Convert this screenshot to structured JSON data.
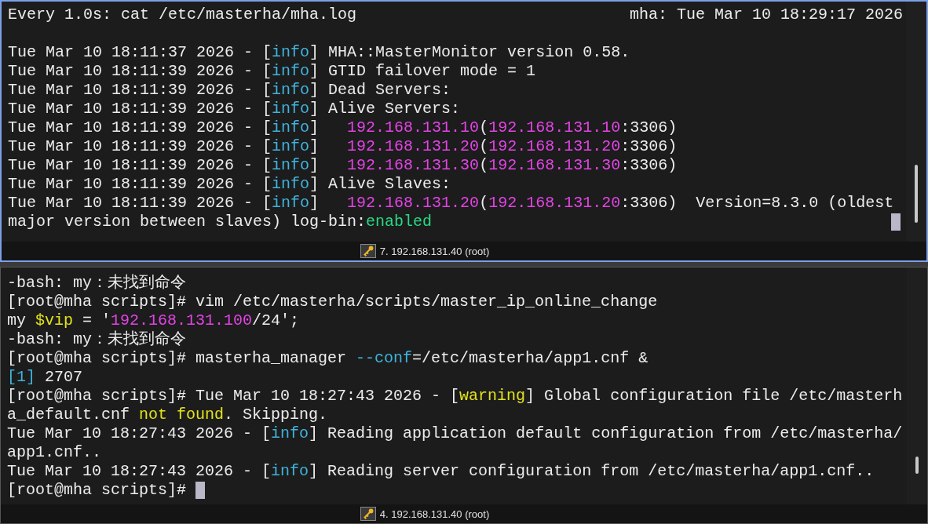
{
  "panes": [
    {
      "active": true,
      "header": {
        "command": "Every 1.0s: cat /etc/masterha/mha.log",
        "clock": "mha: Tue Mar 10 18:29:17 2026"
      },
      "lines": [
        [
          {
            "kind": "plain",
            "text": "Tue Mar 10 18:11:37 2026 - ["
          },
          {
            "kind": "tag",
            "text": "info"
          },
          {
            "kind": "plain",
            "text": "] MHA::MasterMonitor version 0.58."
          }
        ],
        [
          {
            "kind": "plain",
            "text": "Tue Mar 10 18:11:39 2026 - ["
          },
          {
            "kind": "tag",
            "text": "info"
          },
          {
            "kind": "plain",
            "text": "] GTID failover mode = 1"
          }
        ],
        [
          {
            "kind": "plain",
            "text": "Tue Mar 10 18:11:39 2026 - ["
          },
          {
            "kind": "tag",
            "text": "info"
          },
          {
            "kind": "plain",
            "text": "] Dead Servers:"
          }
        ],
        [
          {
            "kind": "plain",
            "text": "Tue Mar 10 18:11:39 2026 - ["
          },
          {
            "kind": "tag",
            "text": "info"
          },
          {
            "kind": "plain",
            "text": "] Alive Servers:"
          }
        ],
        [
          {
            "kind": "plain",
            "text": "Tue Mar 10 18:11:39 2026 - ["
          },
          {
            "kind": "tag",
            "text": "info"
          },
          {
            "kind": "plain",
            "text": "]   "
          },
          {
            "kind": "address",
            "text": "192.168.131.10"
          },
          {
            "kind": "plain",
            "text": "("
          },
          {
            "kind": "address",
            "text": "192.168.131.10"
          },
          {
            "kind": "plain",
            "text": ":3306)"
          }
        ],
        [
          {
            "kind": "plain",
            "text": "Tue Mar 10 18:11:39 2026 - ["
          },
          {
            "kind": "tag",
            "text": "info"
          },
          {
            "kind": "plain",
            "text": "]   "
          },
          {
            "kind": "address",
            "text": "192.168.131.20"
          },
          {
            "kind": "plain",
            "text": "("
          },
          {
            "kind": "address",
            "text": "192.168.131.20"
          },
          {
            "kind": "plain",
            "text": ":3306)"
          }
        ],
        [
          {
            "kind": "plain",
            "text": "Tue Mar 10 18:11:39 2026 - ["
          },
          {
            "kind": "tag",
            "text": "info"
          },
          {
            "kind": "plain",
            "text": "]   "
          },
          {
            "kind": "address",
            "text": "192.168.131.30"
          },
          {
            "kind": "plain",
            "text": "("
          },
          {
            "kind": "address",
            "text": "192.168.131.30"
          },
          {
            "kind": "plain",
            "text": ":3306)"
          }
        ],
        [
          {
            "kind": "plain",
            "text": "Tue Mar 10 18:11:39 2026 - ["
          },
          {
            "kind": "tag",
            "text": "info"
          },
          {
            "kind": "plain",
            "text": "] Alive Slaves:"
          }
        ],
        [
          {
            "kind": "plain",
            "text": "Tue Mar 10 18:11:39 2026 - ["
          },
          {
            "kind": "tag",
            "text": "info"
          },
          {
            "kind": "plain",
            "text": "]   "
          },
          {
            "kind": "address",
            "text": "192.168.131.20"
          },
          {
            "kind": "plain",
            "text": "("
          },
          {
            "kind": "address",
            "text": "192.168.131.20"
          },
          {
            "kind": "plain",
            "text": ":3306)  Version=8.3.0 (oldest"
          }
        ],
        [
          {
            "kind": "plain",
            "text": "major version between slaves) log-bin:"
          },
          {
            "kind": "value",
            "text": "enabled"
          },
          {
            "kind": "margincursor"
          }
        ]
      ],
      "tab": "7. 192.168.131.40 (root)"
    },
    {
      "active": false,
      "lines": [
        [
          {
            "kind": "plain",
            "text": "-bash: my：未找到命令"
          }
        ],
        [
          {
            "kind": "plain",
            "text": "[root@mha scripts]# vim /etc/masterha/scripts/master_ip_online_change"
          }
        ],
        [
          {
            "kind": "plain",
            "text": "my "
          },
          {
            "kind": "warn",
            "text": "$vip"
          },
          {
            "kind": "plain",
            "text": " = '"
          },
          {
            "kind": "address",
            "text": "192.168.131.100"
          },
          {
            "kind": "plain",
            "text": "/24';"
          }
        ],
        [
          {
            "kind": "plain",
            "text": "-bash: my：未找到命令"
          }
        ],
        [
          {
            "kind": "plain",
            "text": "[root@mha scripts]# masterha_manager "
          },
          {
            "kind": "tag",
            "text": "--conf"
          },
          {
            "kind": "plain",
            "text": "=/etc/masterha/app1.cnf &"
          }
        ],
        [
          {
            "kind": "tag",
            "text": "[1]"
          },
          {
            "kind": "plain",
            "text": " 2707"
          }
        ],
        [
          {
            "kind": "plain",
            "text": "[root@mha scripts]# Tue Mar 10 18:27:43 2026 - ["
          },
          {
            "kind": "warn",
            "text": "warning"
          },
          {
            "kind": "plain",
            "text": "] Global configuration file /etc/masterh"
          }
        ],
        [
          {
            "kind": "plain",
            "text": "a_default.cnf "
          },
          {
            "kind": "warn",
            "text": "not found"
          },
          {
            "kind": "plain",
            "text": ". Skipping."
          }
        ],
        [
          {
            "kind": "plain",
            "text": "Tue Mar 10 18:27:43 2026 - ["
          },
          {
            "kind": "tag",
            "text": "info"
          },
          {
            "kind": "plain",
            "text": "] Reading application default configuration from /etc/masterha/"
          }
        ],
        [
          {
            "kind": "plain",
            "text": "app1.cnf.."
          }
        ],
        [
          {
            "kind": "plain",
            "text": "Tue Mar 10 18:27:43 2026 - ["
          },
          {
            "kind": "tag",
            "text": "info"
          },
          {
            "kind": "plain",
            "text": "] Reading server configuration from /etc/masterha/app1.cnf.."
          }
        ],
        [
          {
            "kind": "plain",
            "text": "[root@mha scripts]# "
          },
          {
            "kind": "cursor"
          }
        ]
      ],
      "tab": "4. 192.168.131.40 (root)"
    }
  ]
}
